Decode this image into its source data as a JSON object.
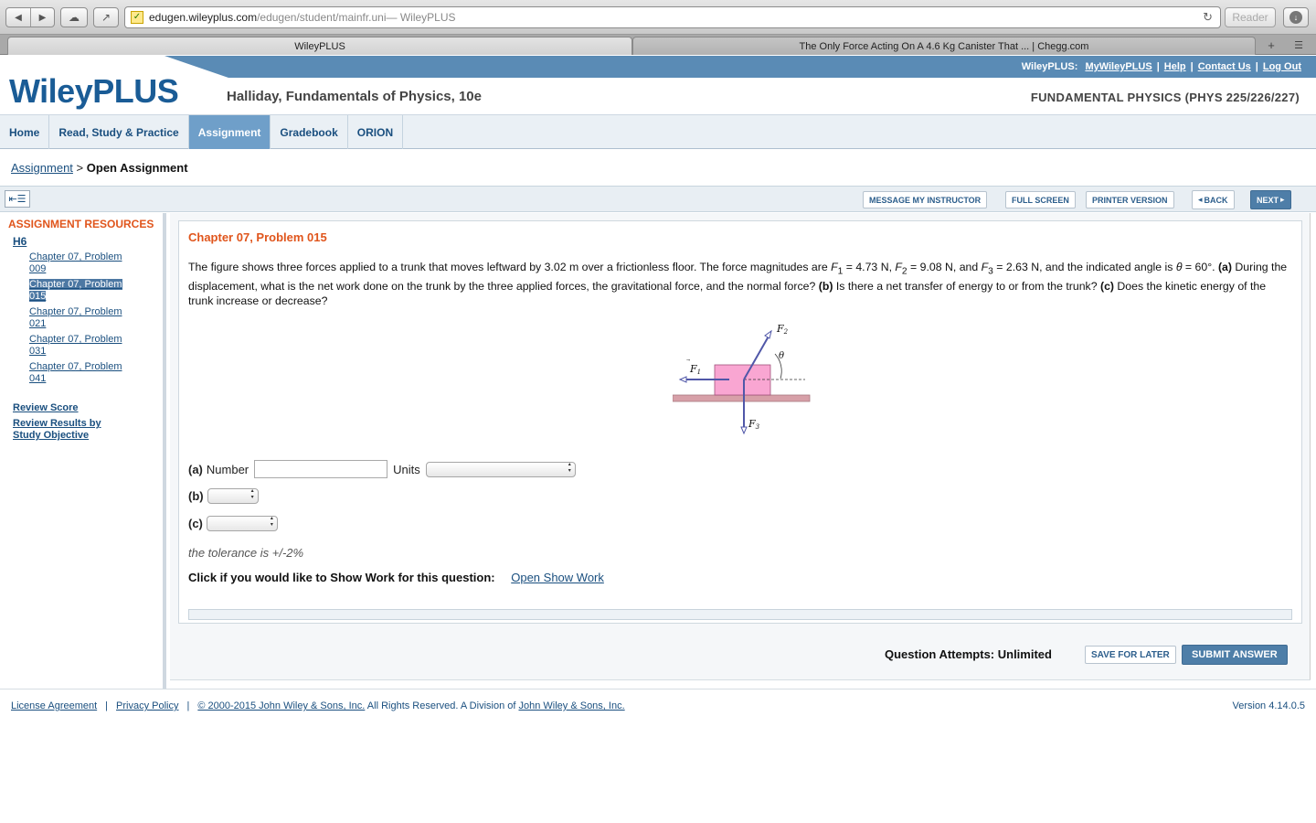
{
  "browser": {
    "url_host": "edugen.wileyplus.com",
    "url_path": "/edugen/student/mainfr.uni",
    "url_suffix": " — WileyPLUS",
    "reader_label": "Reader",
    "tabs": [
      {
        "title": "WileyPLUS"
      },
      {
        "title": "The Only Force Acting On A 4.6 Kg Canister That ... | Chegg.com"
      }
    ]
  },
  "toplinks": {
    "prefix": "WileyPLUS:",
    "items": [
      "MyWileyPLUS",
      "Help",
      "Contact Us",
      "Log Out"
    ]
  },
  "header": {
    "logo": "WileyPLUS",
    "book_title": "Halliday, Fundamentals of Physics, 10e",
    "course_title": "FUNDAMENTAL PHYSICS (PHYS 225/226/227)"
  },
  "nav": {
    "items": [
      "Home",
      "Read, Study & Practice",
      "Assignment",
      "Gradebook",
      "ORION"
    ],
    "active": "Assignment"
  },
  "breadcrumb": {
    "link": "Assignment",
    "separator": ">",
    "current": "Open Assignment"
  },
  "toolbar": {
    "message": "MESSAGE MY INSTRUCTOR",
    "fullscreen": "FULL SCREEN",
    "printer": "PRINTER VERSION",
    "back": "BACK",
    "next": "NEXT"
  },
  "sidebar": {
    "heading": "ASSIGNMENT RESOURCES",
    "group": "H6",
    "items": [
      {
        "line1": "Chapter 07, Problem",
        "line2": "009"
      },
      {
        "line1": "Chapter 07, Problem",
        "line2": "015"
      },
      {
        "line1": "Chapter 07, Problem",
        "line2": "021"
      },
      {
        "line1": "Chapter 07, Problem",
        "line2": "031"
      },
      {
        "line1": "Chapter 07, Problem",
        "line2": "041"
      }
    ],
    "selected_index": 1,
    "review_score": "Review Score",
    "review_results_1": "Review Results by",
    "review_results_2": "Study Objective"
  },
  "problem": {
    "title": "Chapter 07, Problem 015",
    "text_intro": "The figure shows three forces applied to a trunk that moves leftward by 3.02 m over a frictionless floor. The force magnitudes are ",
    "f1": "F",
    "f1_sub": "1",
    "f1_val": " = 4.73 N, ",
    "f2": "F",
    "f2_sub": "2",
    "f2_val": " = 9.08 N, and ",
    "f3": "F",
    "f3_sub": "3",
    "f3_val": " = 2.63 N, and the indicated angle is ",
    "theta": "θ",
    "theta_val": " = 60°. ",
    "part_a": "(a)",
    "text_a": " During the displacement, what is the net work done on the trunk by the three applied forces, the gravitational force, and the normal force? ",
    "part_b": "(b)",
    "text_b": " Is there a net transfer of energy to or from the trunk? ",
    "part_c": "(c)",
    "text_c": " Does the kinetic energy of the trunk increase or decrease?",
    "figure_labels": {
      "f1": "F",
      "f1_sub": "1",
      "f2": "F",
      "f2_sub": "2",
      "f3": "F",
      "f3_sub": "3",
      "theta": "θ"
    },
    "answer_a_label": "(a)",
    "answer_a_number": "Number",
    "answer_a_units": "Units",
    "answer_a_value": "",
    "answer_b_label": "(b)",
    "answer_c_label": "(c)",
    "tolerance": "the tolerance is +/-2%",
    "showwork_prompt": "Click if you would like to Show Work for this question:",
    "showwork_link": "Open Show Work"
  },
  "footer_actions": {
    "attempts": "Question Attempts: Unlimited",
    "save": "SAVE FOR LATER",
    "submit": "SUBMIT ANSWER"
  },
  "footer": {
    "license": "License Agreement",
    "privacy": "Privacy Policy",
    "copyright": "© 2000-2015 John Wiley & Sons, Inc.",
    "rights": " All Rights Reserved. A Division of ",
    "division": "John Wiley & Sons, Inc.",
    "version": "Version 4.14.0.5"
  },
  "colors": {
    "brand_blue": "#1a5c96",
    "accent_orange": "#e0551c",
    "nav_active": "#6f9fc9",
    "trunk_pink": "#f9a6d2",
    "floor": "#d7a0a8",
    "arrow_blue": "#5057a8"
  }
}
